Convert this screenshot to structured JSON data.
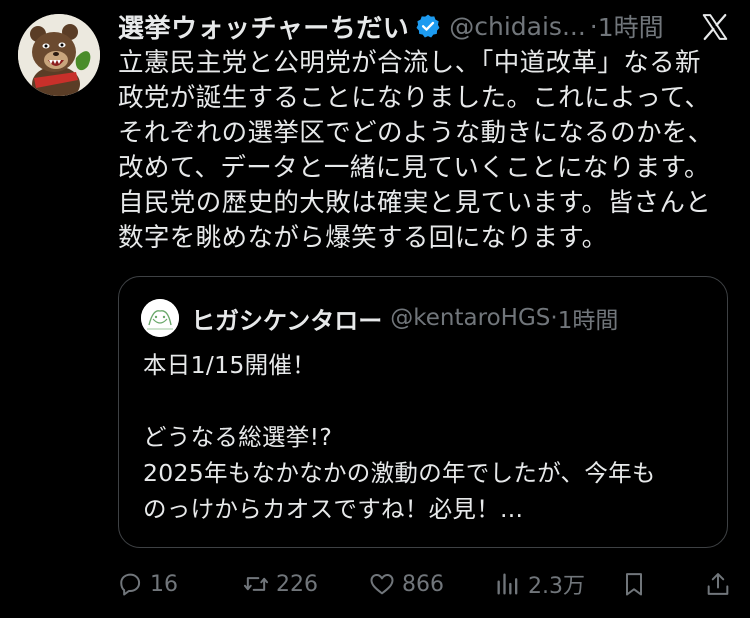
{
  "tweet": {
    "display_name": "選挙ウォッチャーちだい",
    "handle": "@chidais...",
    "separator": "·",
    "time": "1時間",
    "text": "立憲民主党と公明党が合流し、「中道改革」なる新\n政党が誕生することになりました。これによって、\nそれぞれの選挙区でどのような動きになるのかを、\n改めて、データと一緒に見ていくことになります。\n自民党の歴史的大敗は確実と見ています。皆さんと\n数字を眺めながら爆笑する回になります。"
  },
  "quote": {
    "display_name": "ヒガシケンタロー",
    "handle": "@kentaroHGS",
    "separator": "·",
    "time": "1時間",
    "text": "本日1/15開催！\n\nどうなる総選挙!?\n2025年もなかなかの激動の年でしたが、今年も\nのっけからカオスですね！必見！..."
  },
  "actions": {
    "replies": "16",
    "reposts": "226",
    "likes": "866",
    "views": "2.3万"
  },
  "colors": {
    "background": "#000000",
    "text": "#e7e9ea",
    "secondary": "#71767b",
    "verified": "#1d9bf0",
    "border": "#3e4144"
  },
  "icons": {
    "verified": "verified-badge-icon",
    "brand": "x-logo-icon",
    "reply": "reply-icon",
    "repost": "repost-icon",
    "like": "heart-icon",
    "views": "views-icon",
    "bookmark": "bookmark-icon",
    "share": "share-icon"
  }
}
